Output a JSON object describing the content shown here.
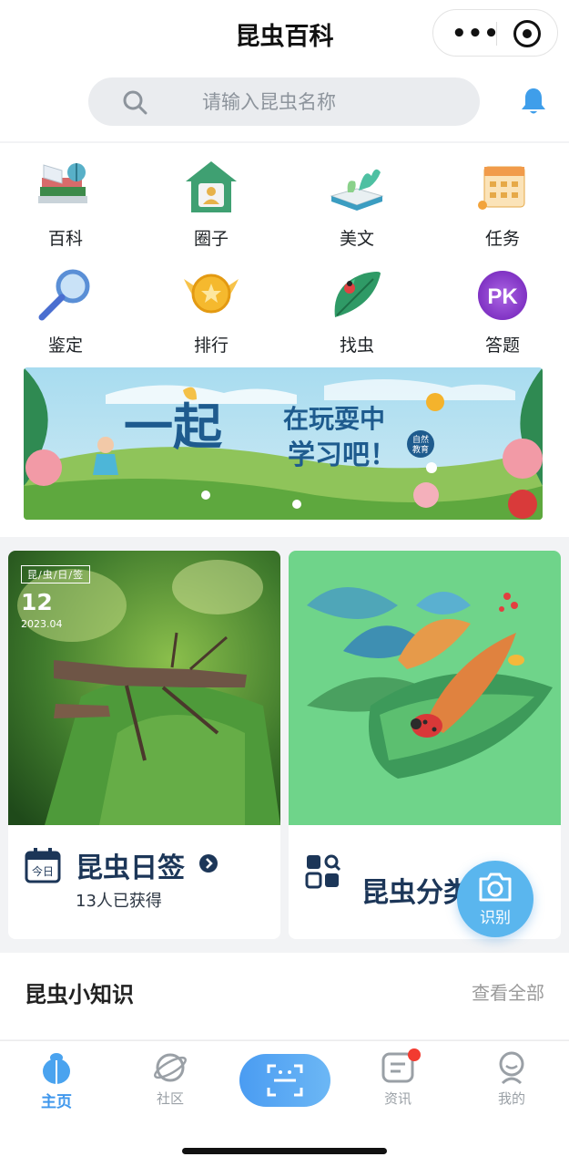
{
  "app": {
    "title": "昆虫百科"
  },
  "search": {
    "placeholder": "请输入昆虫名称"
  },
  "grid": [
    {
      "label": "百科",
      "icon": "encyclopedia-books-icon"
    },
    {
      "label": "圈子",
      "icon": "community-house-icon"
    },
    {
      "label": "美文",
      "icon": "open-book-plant-icon"
    },
    {
      "label": "任务",
      "icon": "calendar-task-icon"
    },
    {
      "label": "鉴定",
      "icon": "magnifier-icon"
    },
    {
      "label": "排行",
      "icon": "gold-medal-icon"
    },
    {
      "label": "找虫",
      "icon": "leaf-ladybug-icon"
    },
    {
      "label": "答题",
      "icon": "pk-badge-icon",
      "badge_text": "PK"
    }
  ],
  "banner": {
    "headline_1": "一起",
    "headline_2": "在玩耍中",
    "headline_3": "学习吧！",
    "seal": "自然教育"
  },
  "daily_card": {
    "stamp": "昆/虫/日/签",
    "day": "12",
    "year_month": "2023.04",
    "title": "昆虫日签",
    "subtitle": "13人已获得"
  },
  "category_card": {
    "title": "昆虫分类"
  },
  "fab": {
    "label": "识别"
  },
  "tips": {
    "title": "昆虫小知识",
    "more": "查看全部"
  },
  "tabbar": [
    {
      "label": "主页",
      "active": true
    },
    {
      "label": "社区",
      "active": false
    },
    {
      "label": "",
      "type": "scan"
    },
    {
      "label": "资讯",
      "active": false,
      "has_dot": true
    },
    {
      "label": "我的",
      "active": false
    }
  ],
  "colors": {
    "accent": "#3f97ec",
    "title_blue": "#1c3658",
    "badge_red": "#f23b30",
    "fab_blue": "#5ab6ee"
  }
}
